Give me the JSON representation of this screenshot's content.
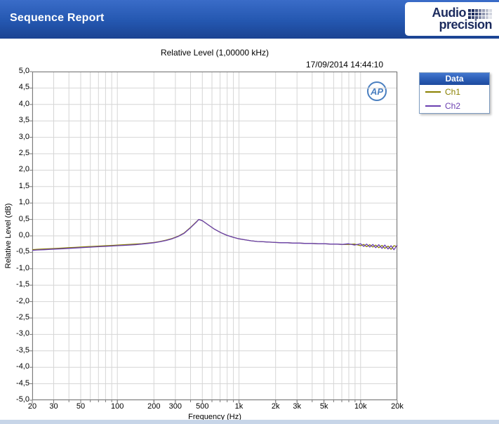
{
  "header": {
    "title": "Sequence Report",
    "logo_line1": "Audio",
    "logo_line2": "precision"
  },
  "chart": {
    "title": "Relative Level (1,00000 kHz)",
    "timestamp": "17/09/2014 14:44:10",
    "xlabel": "Frequency (Hz)",
    "ylabel": "Relative Level (dB)"
  },
  "ap_badge": "AP",
  "legend": {
    "header": "Data",
    "items": [
      {
        "label": "Ch1",
        "color": "#8a8000"
      },
      {
        "label": "Ch2",
        "color": "#6a3fb0"
      }
    ]
  },
  "chart_data": {
    "type": "line",
    "title": "Relative Level (1,00000 kHz)",
    "xlabel": "Frequency (Hz)",
    "ylabel": "Relative Level (dB)",
    "x_scale": "log",
    "xlim": [
      20,
      20000
    ],
    "ylim": [
      -5,
      5
    ],
    "y_step": 0.5,
    "grid": true,
    "grid_color": "#d6d6d6",
    "axis_color": "#7a7a7a",
    "legend_position": "top-right-outside",
    "x_ticks_labeled": [
      {
        "v": 20,
        "label": "20"
      },
      {
        "v": 30,
        "label": "30"
      },
      {
        "v": 50,
        "label": "50"
      },
      {
        "v": 100,
        "label": "100"
      },
      {
        "v": 200,
        "label": "200"
      },
      {
        "v": 300,
        "label": "300"
      },
      {
        "v": 500,
        "label": "500"
      },
      {
        "v": 1000,
        "label": "1k"
      },
      {
        "v": 2000,
        "label": "2k"
      },
      {
        "v": 3000,
        "label": "3k"
      },
      {
        "v": 5000,
        "label": "5k"
      },
      {
        "v": 10000,
        "label": "10k"
      },
      {
        "v": 20000,
        "label": "20k"
      }
    ],
    "x_gridlines": [
      20,
      30,
      40,
      50,
      60,
      70,
      80,
      90,
      100,
      200,
      300,
      400,
      500,
      600,
      700,
      800,
      900,
      1000,
      2000,
      3000,
      4000,
      5000,
      6000,
      7000,
      8000,
      9000,
      10000,
      20000
    ],
    "y_tick_labels": [
      "5,0",
      "4,5",
      "4,0",
      "3,5",
      "3,0",
      "2,5",
      "2,0",
      "1,5",
      "1,0",
      "0,5",
      "0,0",
      "-0,5",
      "-1,0",
      "-1,5",
      "-2,0",
      "-2,5",
      "-3,0",
      "-3,5",
      "-4,0",
      "-4,5",
      "-5,0"
    ],
    "series": [
      {
        "name": "Ch1",
        "color": "#8a8000",
        "x": [
          20,
          22,
          25,
          28,
          32,
          36,
          40,
          45,
          50,
          56,
          63,
          71,
          80,
          90,
          100,
          112,
          126,
          141,
          159,
          178,
          200,
          224,
          251,
          282,
          316,
          355,
          398,
          447,
          468,
          501,
          562,
          631,
          708,
          794,
          891,
          1000,
          1122,
          1259,
          1413,
          1585,
          1778,
          2000,
          2239,
          2512,
          2818,
          3162,
          3548,
          3981,
          4467,
          5012,
          5623,
          6310,
          7079,
          7943,
          8913,
          10000,
          10600,
          11200,
          11900,
          12600,
          13300,
          14100,
          15000,
          15800,
          16800,
          17800,
          18800,
          20000
        ],
        "y": [
          -0.42,
          -0.41,
          -0.4,
          -0.39,
          -0.38,
          -0.37,
          -0.36,
          -0.35,
          -0.34,
          -0.33,
          -0.32,
          -0.31,
          -0.3,
          -0.29,
          -0.28,
          -0.27,
          -0.26,
          -0.25,
          -0.24,
          -0.22,
          -0.2,
          -0.17,
          -0.13,
          -0.08,
          -0.01,
          0.09,
          0.25,
          0.43,
          0.5,
          0.46,
          0.33,
          0.2,
          0.1,
          0.02,
          -0.04,
          -0.09,
          -0.12,
          -0.15,
          -0.17,
          -0.18,
          -0.19,
          -0.2,
          -0.21,
          -0.21,
          -0.22,
          -0.22,
          -0.23,
          -0.23,
          -0.24,
          -0.24,
          -0.25,
          -0.25,
          -0.26,
          -0.26,
          -0.25,
          -0.3,
          -0.26,
          -0.33,
          -0.27,
          -0.34,
          -0.28,
          -0.36,
          -0.29,
          -0.38,
          -0.31,
          -0.41,
          -0.3,
          -0.33
        ]
      },
      {
        "name": "Ch2",
        "color": "#6a3fb0",
        "x": [
          20,
          22,
          25,
          28,
          32,
          36,
          40,
          45,
          50,
          56,
          63,
          71,
          80,
          90,
          100,
          112,
          126,
          141,
          159,
          178,
          200,
          224,
          251,
          282,
          316,
          355,
          398,
          447,
          468,
          501,
          562,
          631,
          708,
          794,
          891,
          1000,
          1122,
          1259,
          1413,
          1585,
          1778,
          2000,
          2239,
          2512,
          2818,
          3162,
          3548,
          3981,
          4467,
          5012,
          5623,
          6310,
          7079,
          7943,
          8913,
          10000,
          10600,
          11200,
          11900,
          12600,
          13300,
          14100,
          15000,
          15800,
          16800,
          17800,
          18800,
          20000
        ],
        "y": [
          -0.44,
          -0.43,
          -0.42,
          -0.41,
          -0.4,
          -0.39,
          -0.38,
          -0.37,
          -0.36,
          -0.35,
          -0.34,
          -0.33,
          -0.32,
          -0.31,
          -0.3,
          -0.29,
          -0.28,
          -0.27,
          -0.25,
          -0.23,
          -0.21,
          -0.18,
          -0.14,
          -0.09,
          -0.02,
          0.08,
          0.24,
          0.42,
          0.5,
          0.46,
          0.33,
          0.2,
          0.1,
          0.02,
          -0.04,
          -0.09,
          -0.12,
          -0.15,
          -0.17,
          -0.18,
          -0.19,
          -0.2,
          -0.21,
          -0.21,
          -0.22,
          -0.22,
          -0.23,
          -0.23,
          -0.24,
          -0.24,
          -0.25,
          -0.25,
          -0.26,
          -0.24,
          -0.28,
          -0.24,
          -0.32,
          -0.25,
          -0.34,
          -0.26,
          -0.36,
          -0.27,
          -0.38,
          -0.28,
          -0.4,
          -0.3,
          -0.42,
          -0.28
        ]
      }
    ]
  }
}
